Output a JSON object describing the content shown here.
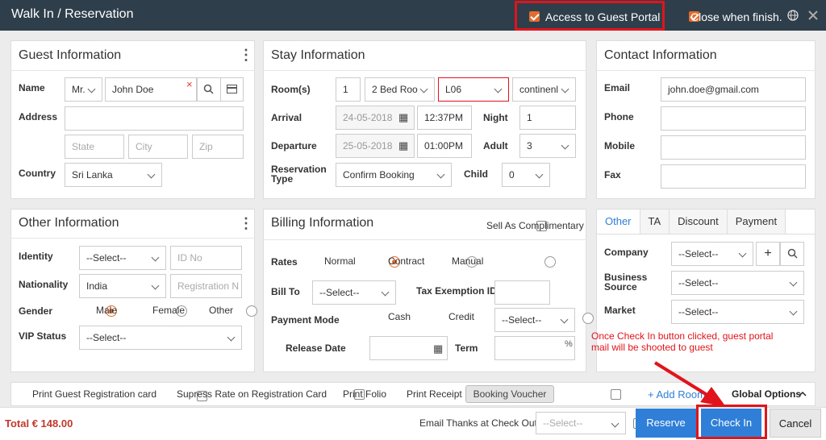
{
  "window": {
    "title": "Walk In / Reservation",
    "access_portal_label": "Access to Guest Portal",
    "close_when_finish_label": "Close when finish."
  },
  "guest": {
    "title": "Guest Information",
    "name_label": "Name",
    "salutation": "Mr.",
    "name_value": "John Doe",
    "address_label": "Address",
    "state_ph": "State",
    "city_ph": "City",
    "zip_ph": "Zip",
    "country_label": "Country",
    "country_value": "Sri Lanka"
  },
  "stay": {
    "title": "Stay Information",
    "rooms_label": "Room(s)",
    "rooms_count": "1",
    "room_type": "2 Bed Roo",
    "room_no": "L06",
    "meal_plan": "continenl",
    "arrival_label": "Arrival",
    "arrival_date": "24-05-2018",
    "arrival_time": "12:37PM",
    "night_label": "Night",
    "night_value": "1",
    "departure_label": "Departure",
    "departure_date": "25-05-2018",
    "departure_time": "01:00PM",
    "adult_label": "Adult",
    "adult_value": "3",
    "res_type_label_1": "Reservation",
    "res_type_label_2": "Type",
    "res_type_value": "Confirm Booking",
    "child_label": "Child",
    "child_value": "0"
  },
  "contact": {
    "title": "Contact Information",
    "email_label": "Email",
    "email_value": "john.doe@gmail.com",
    "phone_label": "Phone",
    "mobile_label": "Mobile",
    "fax_label": "Fax"
  },
  "other": {
    "title": "Other Information",
    "identity_label": "Identity",
    "identity_value": "--Select--",
    "id_no_ph": "ID No",
    "nationality_label": "Nationality",
    "nationality_value": "India",
    "reg_ph": "Registration N",
    "gender_label": "Gender",
    "male": "Male",
    "female": "Female",
    "other": "Other",
    "vip_label": "VIP Status",
    "vip_value": "--Select--"
  },
  "billing": {
    "title": "Billing Information",
    "complimentary_label": "Sell As Complimentary",
    "rates_label": "Rates",
    "normal": "Normal",
    "contract": "Contract",
    "manual": "Manual",
    "bill_to_label": "Bill To",
    "bill_to_value": "--Select--",
    "tax_label": "Tax Exemption ID",
    "payment_label": "Payment Mode",
    "cash": "Cash",
    "credit": "Credit",
    "payment_value": "--Select--",
    "release_label": "Release Date",
    "term_label": "Term",
    "percent": "%"
  },
  "tabs": {
    "items": [
      "Other",
      "TA",
      "Discount",
      "Payment"
    ],
    "company_label": "Company",
    "company_value": "--Select--",
    "business_label_1": "Business",
    "business_label_2": "Source",
    "business_value": "--Select--",
    "market_label": "Market",
    "market_value": "--Select--"
  },
  "annotation": {
    "line1": "Once Check In button clicked, guest portal",
    "line2": "mail will be shooted to guest"
  },
  "options": {
    "print_reg": "Print Guest Registration card",
    "suppress_rate": "Supress Rate on Registration Card",
    "print_folio": "Print Folio",
    "print_receipt": "Print Receipt",
    "booking_voucher": "Booking Voucher",
    "add_room": "+ Add Room",
    "global_options": "Global Options"
  },
  "footer": {
    "total": "Total € 148.00",
    "email_thanks": "Email Thanks at Check Out",
    "email_select": "--Select--",
    "reserve": "Reserve",
    "check_in": "Check In",
    "cancel": "Cancel"
  },
  "colors": {
    "accent": "#e06d2f",
    "primary": "#2f7ed8",
    "titlebar": "#2f3e4b",
    "highlight": "#e0141a"
  }
}
